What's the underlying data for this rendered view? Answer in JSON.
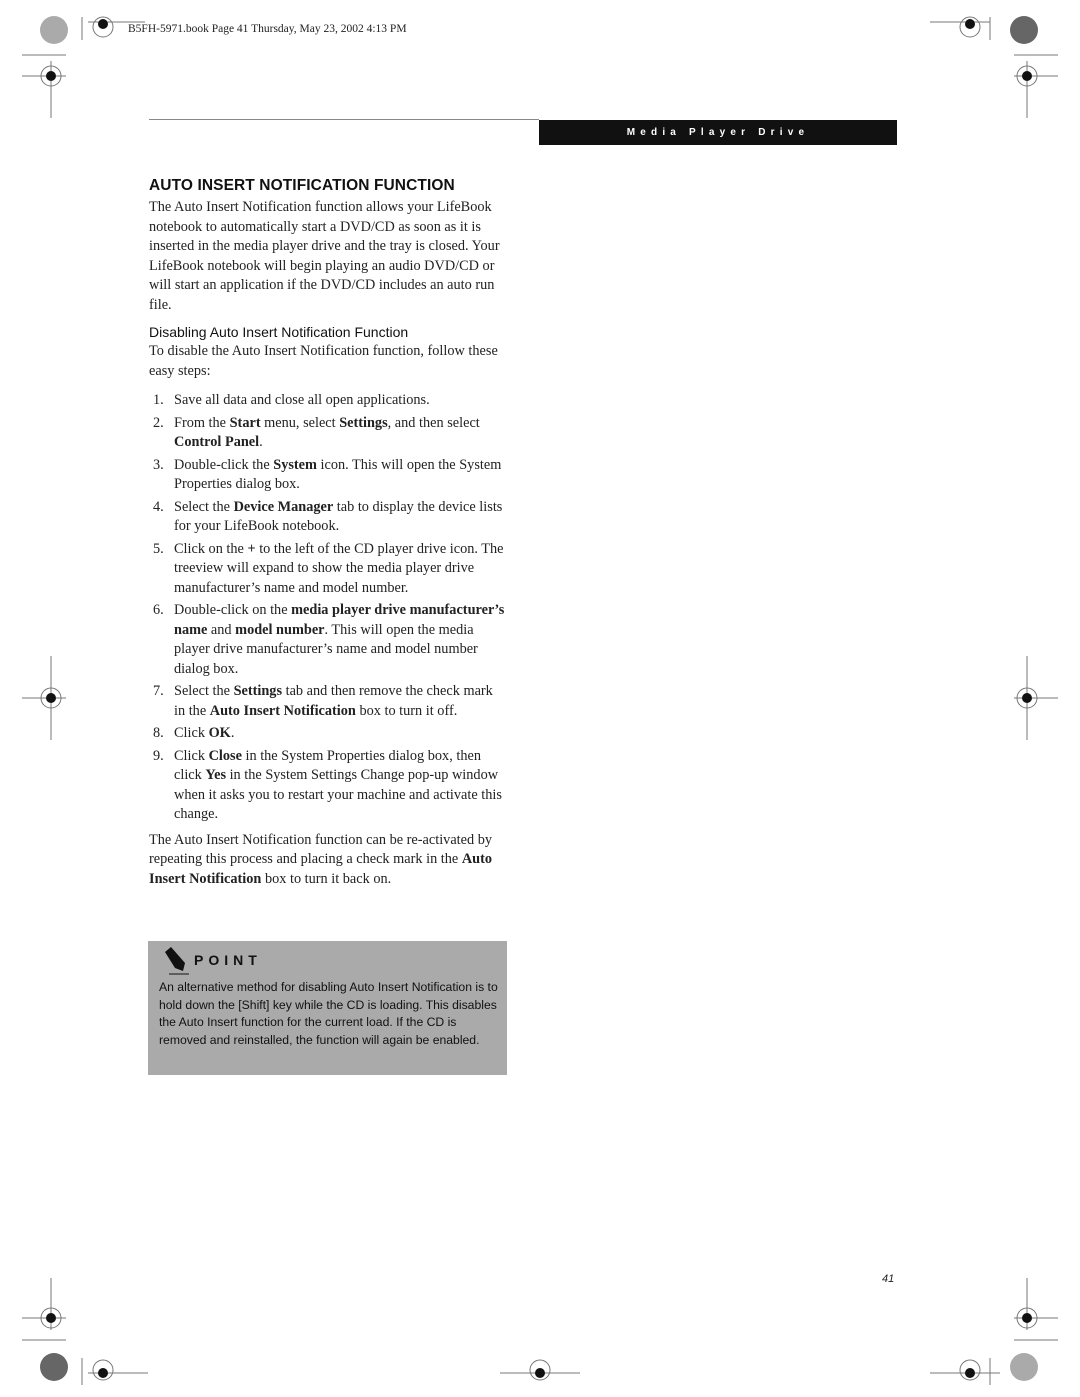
{
  "slug": "B5FH-5971.book  Page 41  Thursday, May 23, 2002  4:13 PM",
  "section_header": "Media Player Drive",
  "heading": "AUTO INSERT NOTIFICATION FUNCTION",
  "intro": "The Auto Insert Notification function allows your LifeBook notebook to automatically start a DVD/CD as soon as it is inserted in the media player drive and the tray is closed. Your LifeBook notebook will begin playing an audio DVD/CD or will start an application if the DVD/CD includes an auto run file.",
  "subheading": "Disabling Auto Insert Notification Function",
  "sub_intro": "To disable the Auto Insert Notification function, follow these easy steps:",
  "steps": [
    {
      "num": "1.",
      "parts": [
        {
          "t": "Save all data and close all open applications."
        }
      ]
    },
    {
      "num": "2.",
      "parts": [
        {
          "t": "From the "
        },
        {
          "t": "Start",
          "b": true
        },
        {
          "t": " menu, select "
        },
        {
          "t": "Settings",
          "b": true
        },
        {
          "t": ", and then select "
        },
        {
          "t": "Control Panel",
          "b": true
        },
        {
          "t": "."
        }
      ]
    },
    {
      "num": "3.",
      "parts": [
        {
          "t": "Double-click the "
        },
        {
          "t": "System",
          "b": true
        },
        {
          "t": " icon. This will open the System Properties dialog box."
        }
      ]
    },
    {
      "num": "4.",
      "parts": [
        {
          "t": "Select the "
        },
        {
          "t": "Device Manager",
          "b": true
        },
        {
          "t": " tab to display the device lists for your LifeBook notebook."
        }
      ]
    },
    {
      "num": "5.",
      "parts": [
        {
          "t": "Click on the "
        },
        {
          "t": "+",
          "b": true
        },
        {
          "t": " to the left of the CD player drive icon. The treeview will expand to show the media player drive manufacturer’s name and model number."
        }
      ]
    },
    {
      "num": "6.",
      "parts": [
        {
          "t": "Double-click on the "
        },
        {
          "t": "media player drive manufacturer’s name",
          "b": true
        },
        {
          "t": " and "
        },
        {
          "t": "model number",
          "b": true
        },
        {
          "t": ". This will open the media player drive manufacturer’s name and model number dialog box."
        }
      ]
    },
    {
      "num": "7.",
      "parts": [
        {
          "t": "Select the "
        },
        {
          "t": "Settings",
          "b": true
        },
        {
          "t": " tab and then remove the check mark in the "
        },
        {
          "t": "Auto Insert Notification",
          "b": true
        },
        {
          "t": " box to turn it off."
        }
      ]
    },
    {
      "num": "8.",
      "parts": [
        {
          "t": "Click "
        },
        {
          "t": "OK",
          "b": true
        },
        {
          "t": "."
        }
      ]
    },
    {
      "num": "9.",
      "parts": [
        {
          "t": "Click "
        },
        {
          "t": "Close",
          "b": true
        },
        {
          "t": " in the System Properties dialog box, then click "
        },
        {
          "t": "Yes",
          "b": true
        },
        {
          "t": " in the System Settings Change pop-up window when it asks you to restart your machine and activate this change."
        }
      ]
    }
  ],
  "closing": [
    {
      "t": "The Auto Insert Notification function can be re-activated by repeating this process and placing a check mark in the "
    },
    {
      "t": "Auto Insert Notification",
      "b": true
    },
    {
      "t": " box to turn it back on."
    }
  ],
  "point": {
    "title": "POINT",
    "icon": "pencil-icon",
    "text": "An alternative method for disabling Auto Insert Notification is to hold down the [Shift] key while the CD is loading. This disables the Auto Insert function for the current load. If the CD is removed and reinstalled, the function will again be enabled."
  },
  "page_number": "41"
}
